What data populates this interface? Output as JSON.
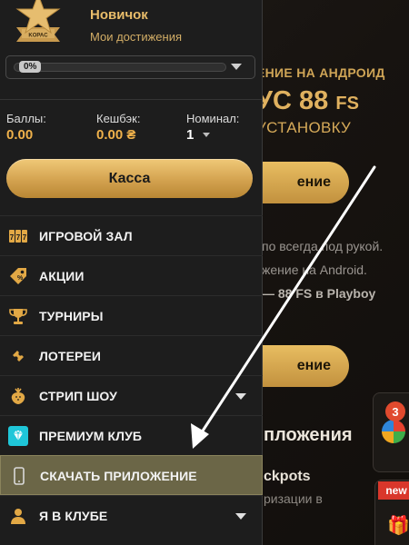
{
  "background": {
    "promo_subtitle": "ЕНИЕ НА АНДРОИД",
    "promo_title": "УС 88",
    "promo_title_suffix": "FS",
    "promo_line3": "УСТАНОВКУ",
    "button1_label": "ение",
    "text_line1": "по всегда под рукой.",
    "text_line2": "жение на Android.",
    "text_line3": "— 88 FS в Playboy",
    "button2_label": "ение",
    "section_title": "пложения",
    "jackpots_title": "ckpots",
    "jackpots_subtitle": "ризации в",
    "badge_count": "3",
    "new_badge": "new"
  },
  "profile": {
    "name": "Новичок",
    "achievements": "Мои достижения",
    "progress_label": "0%",
    "progress": 0
  },
  "stats": {
    "points_label": "Баллы:",
    "points_value": "0.00",
    "cashback_label": "Кешбэк:",
    "cashback_value": "0.00 ₴",
    "nominal_label": "Номинал:",
    "nominal_value": "1"
  },
  "kassa_label": "Касса",
  "menu": [
    {
      "label": "ИГРОВОЙ ЗАЛ",
      "icon": "slots-icon"
    },
    {
      "label": "АКЦИИ",
      "icon": "tag-icon"
    },
    {
      "label": "ТУРНИРЫ",
      "icon": "trophy-icon"
    },
    {
      "label": "ЛОТЕРЕИ",
      "icon": "ticket-icon"
    },
    {
      "label": "СТРИП ШОУ",
      "icon": "strawberry-icon"
    },
    {
      "label": "ПРЕМИУМ КЛУБ",
      "icon": "diamond-icon"
    },
    {
      "label": "СКАЧАТЬ ПРИЛОЖЕНИЕ",
      "icon": "phone-icon"
    },
    {
      "label": "Я В КЛУБЕ",
      "icon": "user-icon"
    }
  ],
  "colors": {
    "gold": "#e9bd6a",
    "stat_value": "#f0b24b",
    "active_item": "#6b6647",
    "drawer_bg": "#1d1d1d"
  }
}
